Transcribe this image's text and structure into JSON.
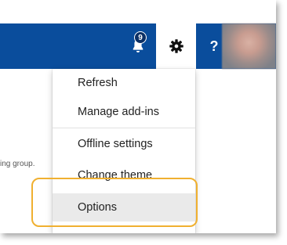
{
  "header": {
    "notifications_count": "9",
    "help_label": "?"
  },
  "background": {
    "partial_text": "ing group."
  },
  "settings_menu": {
    "items": [
      {
        "label": "Refresh"
      },
      {
        "label": "Manage add-ins"
      },
      {
        "label": "Offline settings"
      },
      {
        "label": "Change theme"
      },
      {
        "label": "Options"
      }
    ]
  },
  "icons": [
    "bell-icon",
    "gear-icon",
    "help-icon"
  ],
  "colors": {
    "header_bg": "#0a4d9c",
    "highlight_border": "#f0b030",
    "active_item_bg": "#eaeaea"
  }
}
